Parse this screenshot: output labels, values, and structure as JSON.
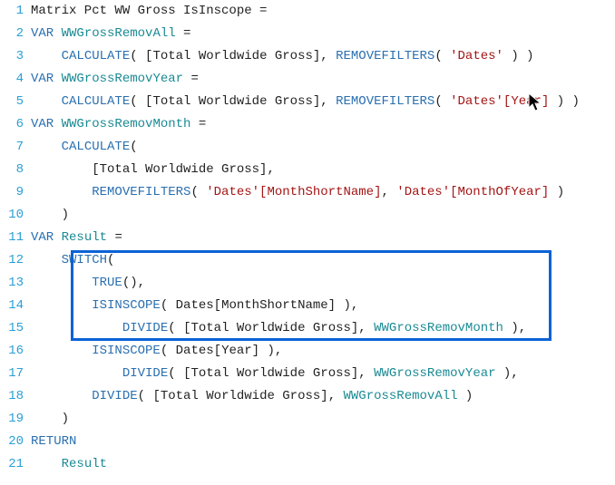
{
  "editor": {
    "measure_name": "Matrix Pct WW Gross IsInscope",
    "variables": {
      "remov_all": "WWGrossRemovAll",
      "remov_year": "WWGrossRemovYear",
      "remov_month": "WWGrossRemovMonth",
      "result": "Result"
    },
    "functions": {
      "var": "VAR",
      "return": "RETURN",
      "calculate": "CALCULATE",
      "removefilters": "REMOVEFILTERS",
      "switch": "SWITCH",
      "true": "TRUE",
      "isinscope": "ISINSCOPE",
      "divide": "DIVIDE"
    },
    "refs": {
      "total_ww_gross": "[Total Worldwide Gross]",
      "dates_table": "'Dates'",
      "dates_year": "'Dates'[Year]",
      "dates_month_short": "'Dates'[MonthShortName]",
      "dates_month_of_year": "'Dates'[MonthOfYear]",
      "dates_month_short_bare": "Dates[MonthShortName]",
      "dates_year_bare": "Dates[Year]"
    },
    "line_numbers": [
      "1",
      "2",
      "3",
      "4",
      "5",
      "6",
      "7",
      "8",
      "9",
      "10",
      "11",
      "12",
      "13",
      "14",
      "15",
      "16",
      "17",
      "18",
      "19",
      "20",
      "21"
    ]
  },
  "icons": {
    "cursor": "cursor-pointer-icon"
  }
}
